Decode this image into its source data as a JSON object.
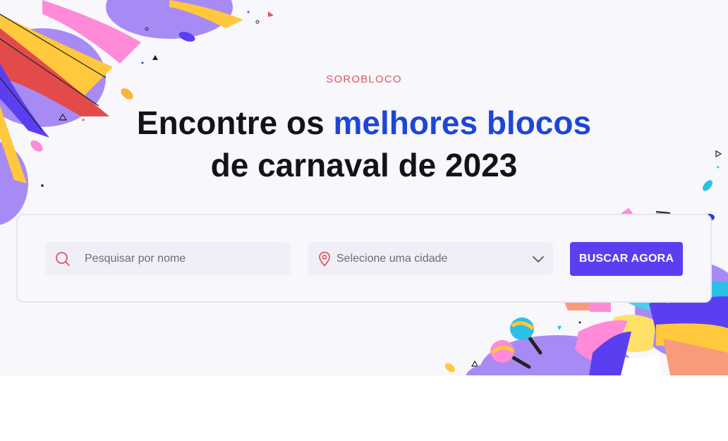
{
  "hero": {
    "eyebrow": "SOROBLOCO",
    "headline_part1": "Encontre os ",
    "headline_highlight": "melhores blocos",
    "headline_part2": "de carnaval de 2023"
  },
  "search": {
    "name_placeholder": "Pesquisar por nome",
    "name_value": "",
    "city_select_value": "Selecione uma cidade",
    "button_label": "BUSCAR AGORA"
  },
  "icons": {
    "search": "search-icon",
    "location": "map-pin-icon",
    "dropdown": "chevron-down-icon"
  },
  "colors": {
    "eyebrow": "#e05563",
    "highlight": "#1e46d6",
    "button": "#5a3ff0",
    "background": "#f7f7fc"
  }
}
